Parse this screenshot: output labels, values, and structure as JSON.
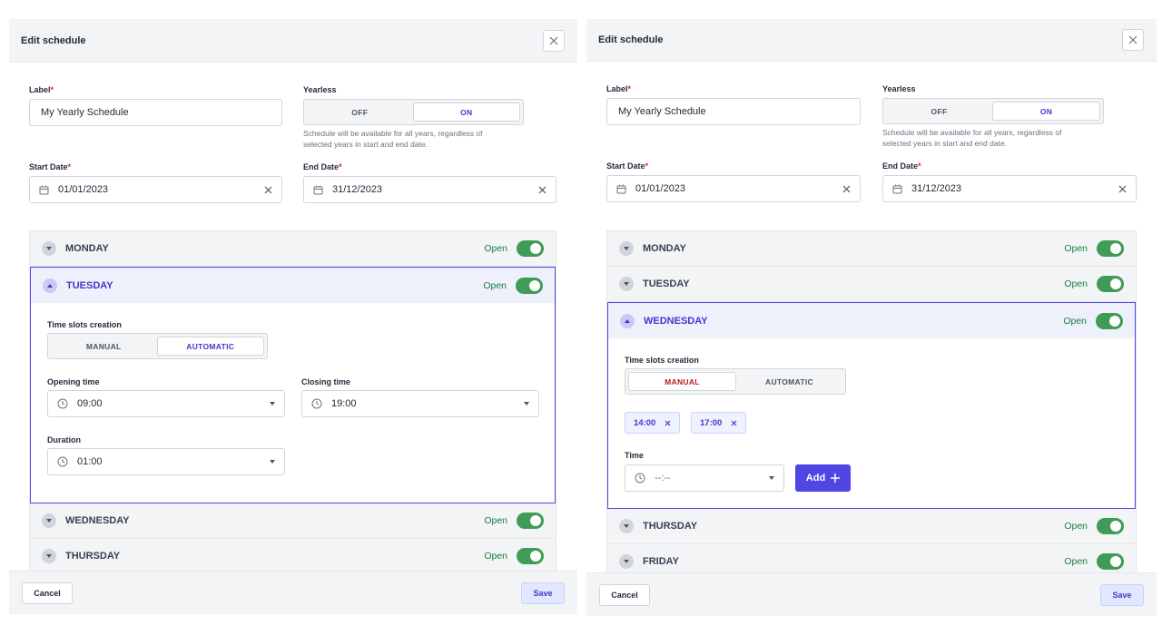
{
  "left": {
    "title": "Edit schedule",
    "label_field": {
      "label": "Label",
      "value": "My Yearly Schedule"
    },
    "yearless": {
      "label": "Yearless",
      "off": "OFF",
      "on": "ON",
      "selected": "ON",
      "help_line1": "Schedule will be available for all years, regardless of",
      "help_line2": "selected years in start and end date."
    },
    "start_date": {
      "label": "Start Date",
      "value": "01/01/2023"
    },
    "end_date": {
      "label": "End Date",
      "value": "31/12/2023"
    },
    "days": [
      {
        "name": "MONDAY",
        "status": "Open",
        "expanded": false
      },
      {
        "name": "TUESDAY",
        "status": "Open",
        "expanded": true
      },
      {
        "name": "WEDNESDAY",
        "status": "Open",
        "expanded": false
      },
      {
        "name": "THURSDAY",
        "status": "Open",
        "expanded": false
      }
    ],
    "expanded": {
      "slots_label": "Time slots creation",
      "manual": "MANUAL",
      "automatic": "AUTOMATIC",
      "selected_mode": "AUTOMATIC",
      "opening_label": "Opening time",
      "opening_value": "09:00",
      "closing_label": "Closing time",
      "closing_value": "19:00",
      "duration_label": "Duration",
      "duration_value": "01:00"
    },
    "cancel": "Cancel",
    "save": "Save"
  },
  "right": {
    "title": "Edit schedule",
    "label_field": {
      "label": "Label",
      "value": "My Yearly Schedule"
    },
    "yearless": {
      "label": "Yearless",
      "off": "OFF",
      "on": "ON",
      "selected": "ON",
      "help_line1": "Schedule will be available for all years, regardless of",
      "help_line2": "selected years in start and end date."
    },
    "start_date": {
      "label": "Start Date",
      "value": "01/01/2023"
    },
    "end_date": {
      "label": "End Date",
      "value": "31/12/2023"
    },
    "days": [
      {
        "name": "MONDAY",
        "status": "Open",
        "expanded": false
      },
      {
        "name": "TUESDAY",
        "status": "Open",
        "expanded": false
      },
      {
        "name": "WEDNESDAY",
        "status": "Open",
        "expanded": true
      },
      {
        "name": "THURSDAY",
        "status": "Open",
        "expanded": false
      },
      {
        "name": "FRIDAY",
        "status": "Open",
        "expanded": false
      }
    ],
    "expanded": {
      "slots_label": "Time slots creation",
      "manual": "MANUAL",
      "automatic": "AUTOMATIC",
      "selected_mode": "MANUAL",
      "slots": [
        "14:00",
        "17:00"
      ],
      "time_label": "Time",
      "time_placeholder": "--:--",
      "add_label": "Add"
    },
    "cancel": "Cancel",
    "save": "Save"
  },
  "colors": {
    "accent": "#4f46e5",
    "open_green": "#15803d",
    "toggle_green": "#3f9b55",
    "required_red": "#dc2626",
    "manual_red": "#b91c1c"
  }
}
